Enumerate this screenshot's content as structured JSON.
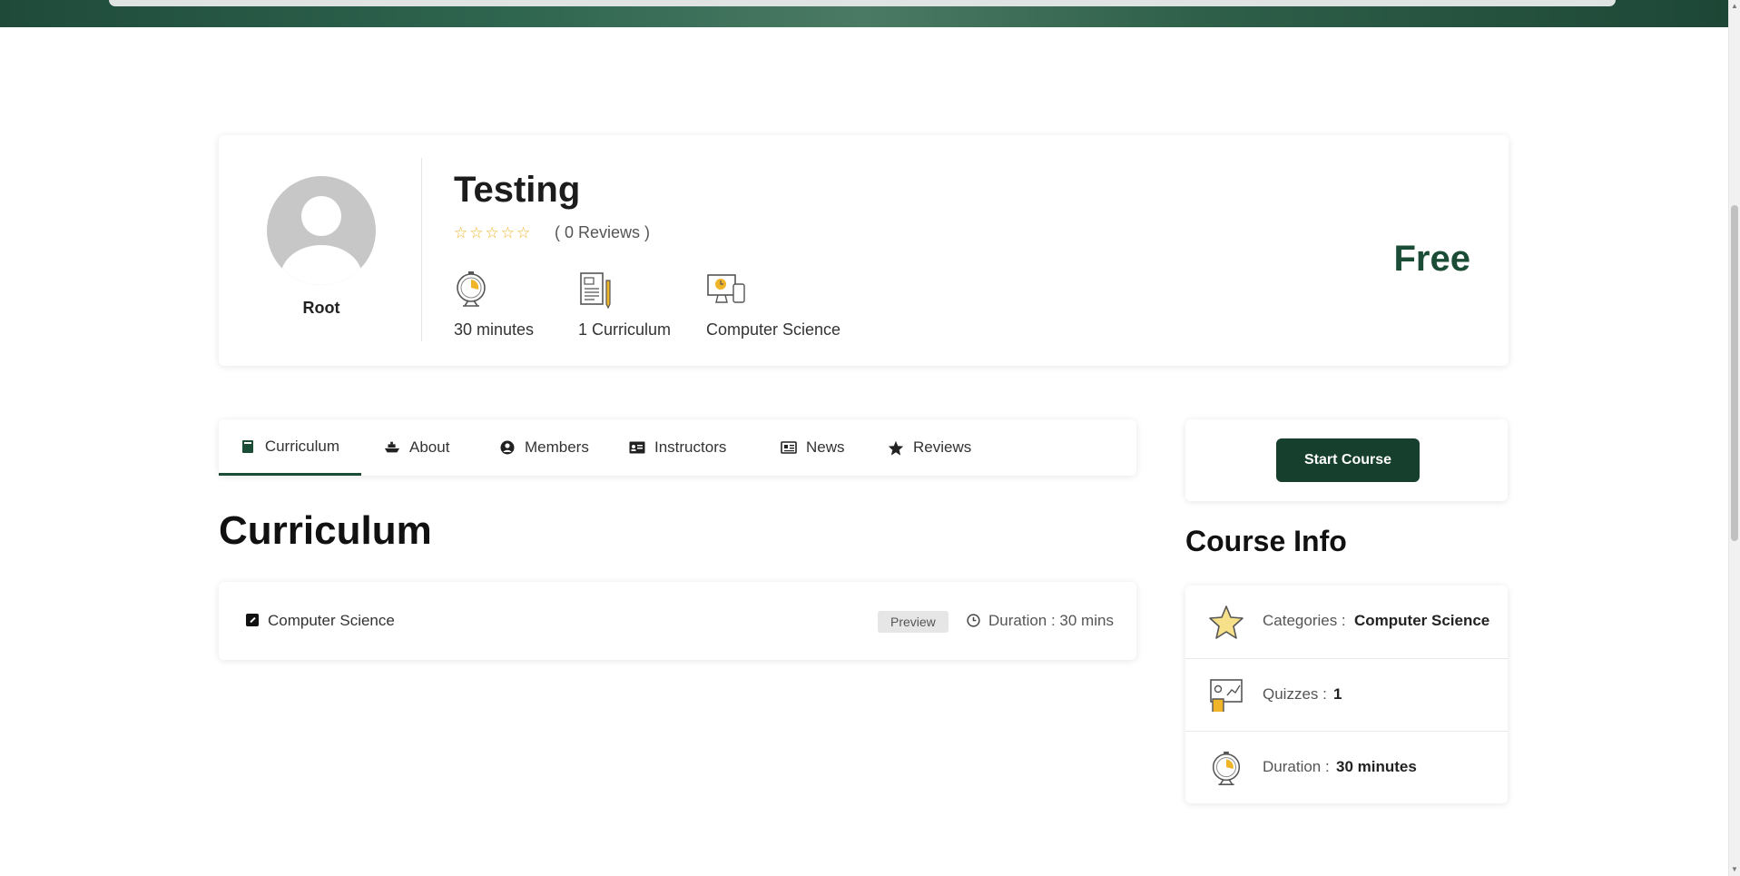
{
  "instructor": {
    "name": "Root"
  },
  "course": {
    "title": "Testing",
    "rating_stars": "☆☆☆☆☆",
    "reviews_text": "( 0 Reviews )",
    "price": "Free",
    "meta": [
      {
        "icon": "stopwatch-icon",
        "label": "30 minutes"
      },
      {
        "icon": "document-icon",
        "label": "1 Curriculum"
      },
      {
        "icon": "computer-devices-icon",
        "label": "Computer Science"
      }
    ]
  },
  "tabs": [
    {
      "label": "Curriculum",
      "icon": "book-icon",
      "active": true
    },
    {
      "label": "About",
      "icon": "ship-icon"
    },
    {
      "label": "Members",
      "icon": "user-circle-icon"
    },
    {
      "label": "Instructors",
      "icon": "id-card-icon"
    },
    {
      "label": "News",
      "icon": "newspaper-icon"
    },
    {
      "label": "Reviews",
      "icon": "star-icon"
    }
  ],
  "curriculum": {
    "title": "Curriculum",
    "lessons": [
      {
        "name": "Computer Science",
        "badge": "Preview",
        "duration": "Duration : 30 mins"
      }
    ]
  },
  "sidebar": {
    "start_button": "Start Course",
    "info_title": "Course Info",
    "info": [
      {
        "key": "Categories :",
        "value": "Computer Science",
        "icon": "star-outline-icon"
      },
      {
        "key": "Quizzes :",
        "value": "1",
        "icon": "presentation-board-icon"
      },
      {
        "key": "Duration :",
        "value": "30 minutes",
        "icon": "stopwatch-icon"
      }
    ]
  },
  "colors": {
    "brand": "#1b4d36",
    "button": "#173f2d",
    "star": "#f0b429"
  }
}
